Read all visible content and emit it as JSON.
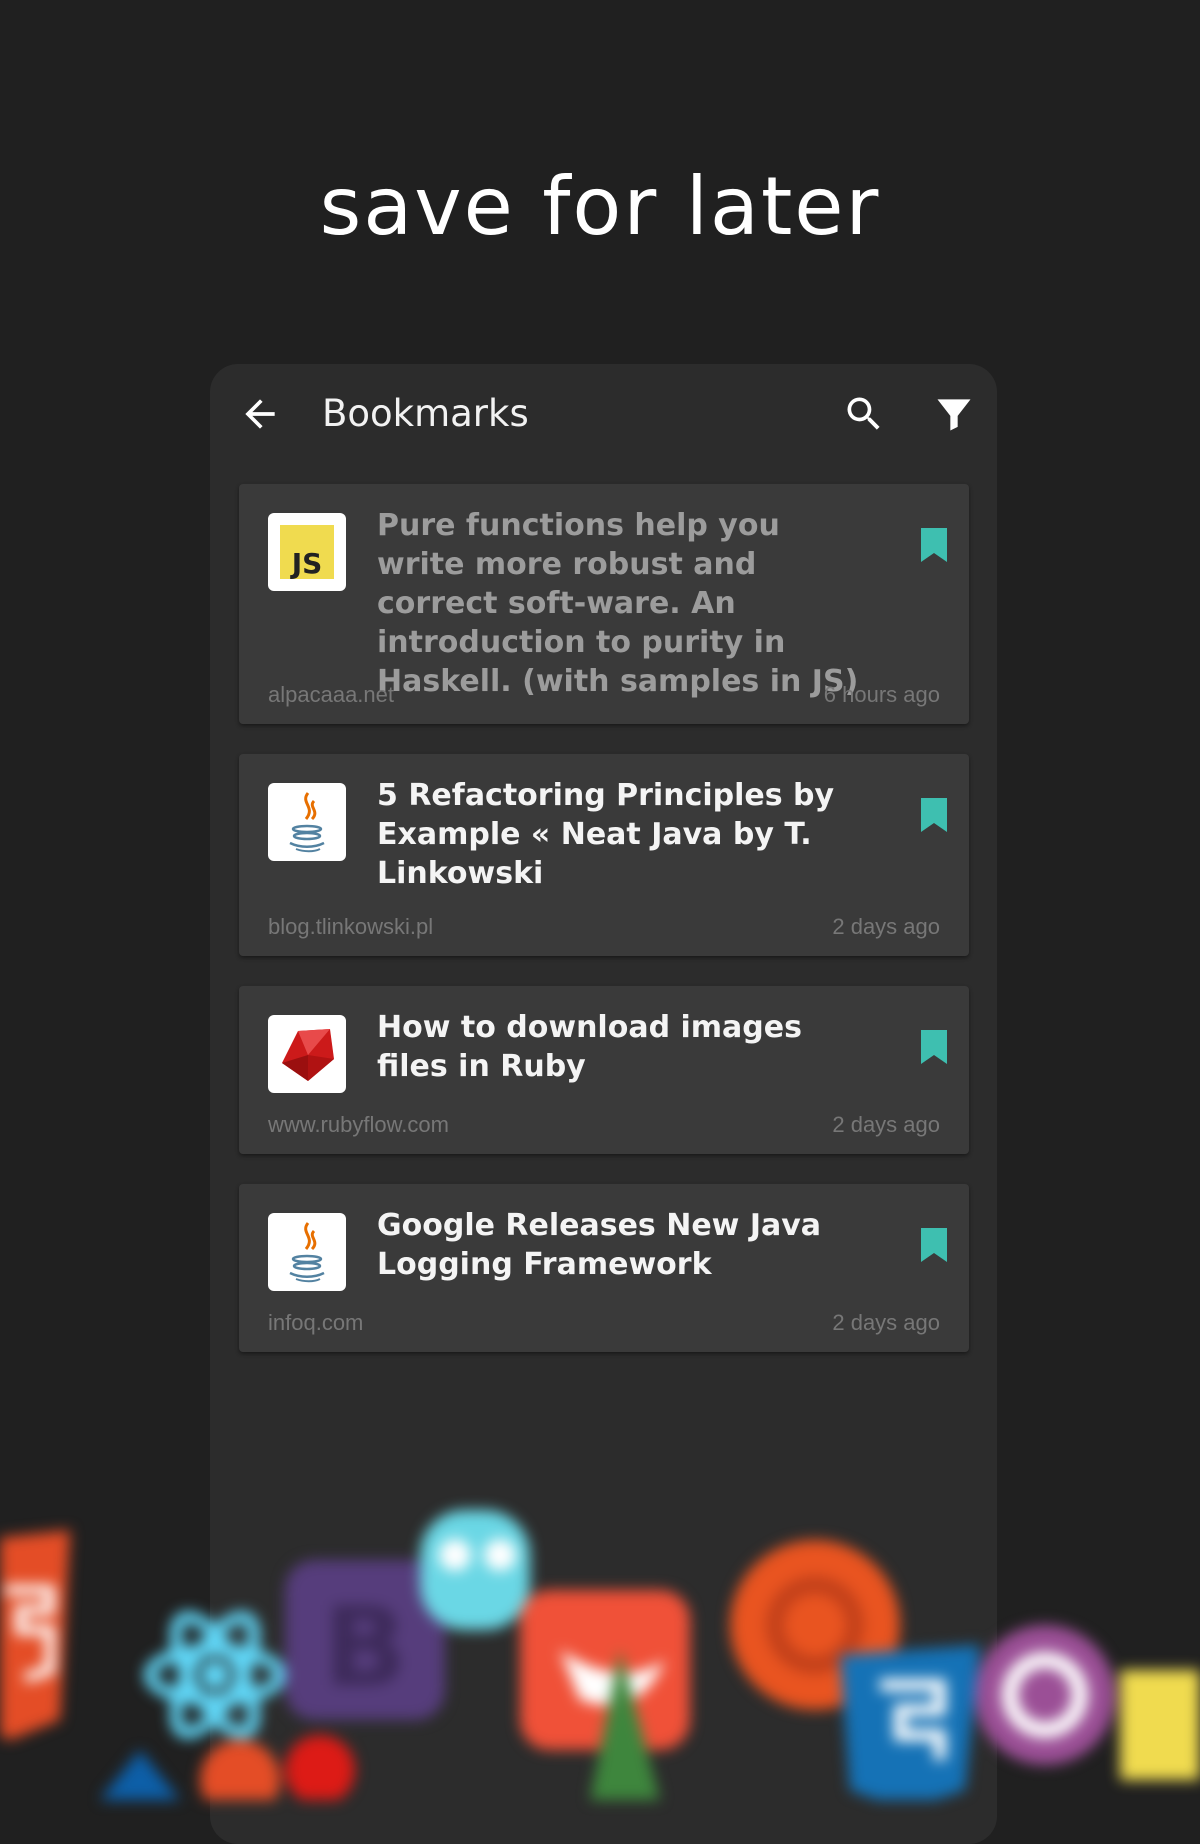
{
  "headline": "save for later",
  "toolbar": {
    "title": "Bookmarks",
    "back_icon": "arrow-left-icon",
    "search_icon": "search-icon",
    "filter_icon": "filter-icon"
  },
  "accent_color": "#3ebfb0",
  "bookmarks": [
    {
      "title": "Pure functions help you write more robust and correct soft-ware. An introduction to purity in Haskell. (with samples in JS)",
      "domain": "alpacaaa.net",
      "time": "6 hours ago",
      "icon": "javascript-logo-icon",
      "read": true
    },
    {
      "title": "5 Refactoring Principles by Example « Neat Java by T. Linkowski",
      "domain": "blog.tlinkowski.pl",
      "time": "2 days ago",
      "icon": "java-logo-icon",
      "read": false
    },
    {
      "title": "How to download images files in Ruby",
      "domain": "www.rubyflow.com",
      "time": "2 days ago",
      "icon": "ruby-logo-icon",
      "read": false
    },
    {
      "title": "Google Releases New Java Logging Framework",
      "domain": "infoq.com",
      "time": "2 days ago",
      "icon": "java-logo-icon",
      "read": false
    }
  ],
  "background_logos": [
    "html5-logo-icon",
    "react-logo-icon",
    "bootstrap-logo-icon",
    "go-gopher-icon",
    "swift-logo-icon",
    "ubuntu-logo-icon",
    "css3-logo-icon",
    "csharp-logo-icon",
    "javascript-logo-icon"
  ]
}
